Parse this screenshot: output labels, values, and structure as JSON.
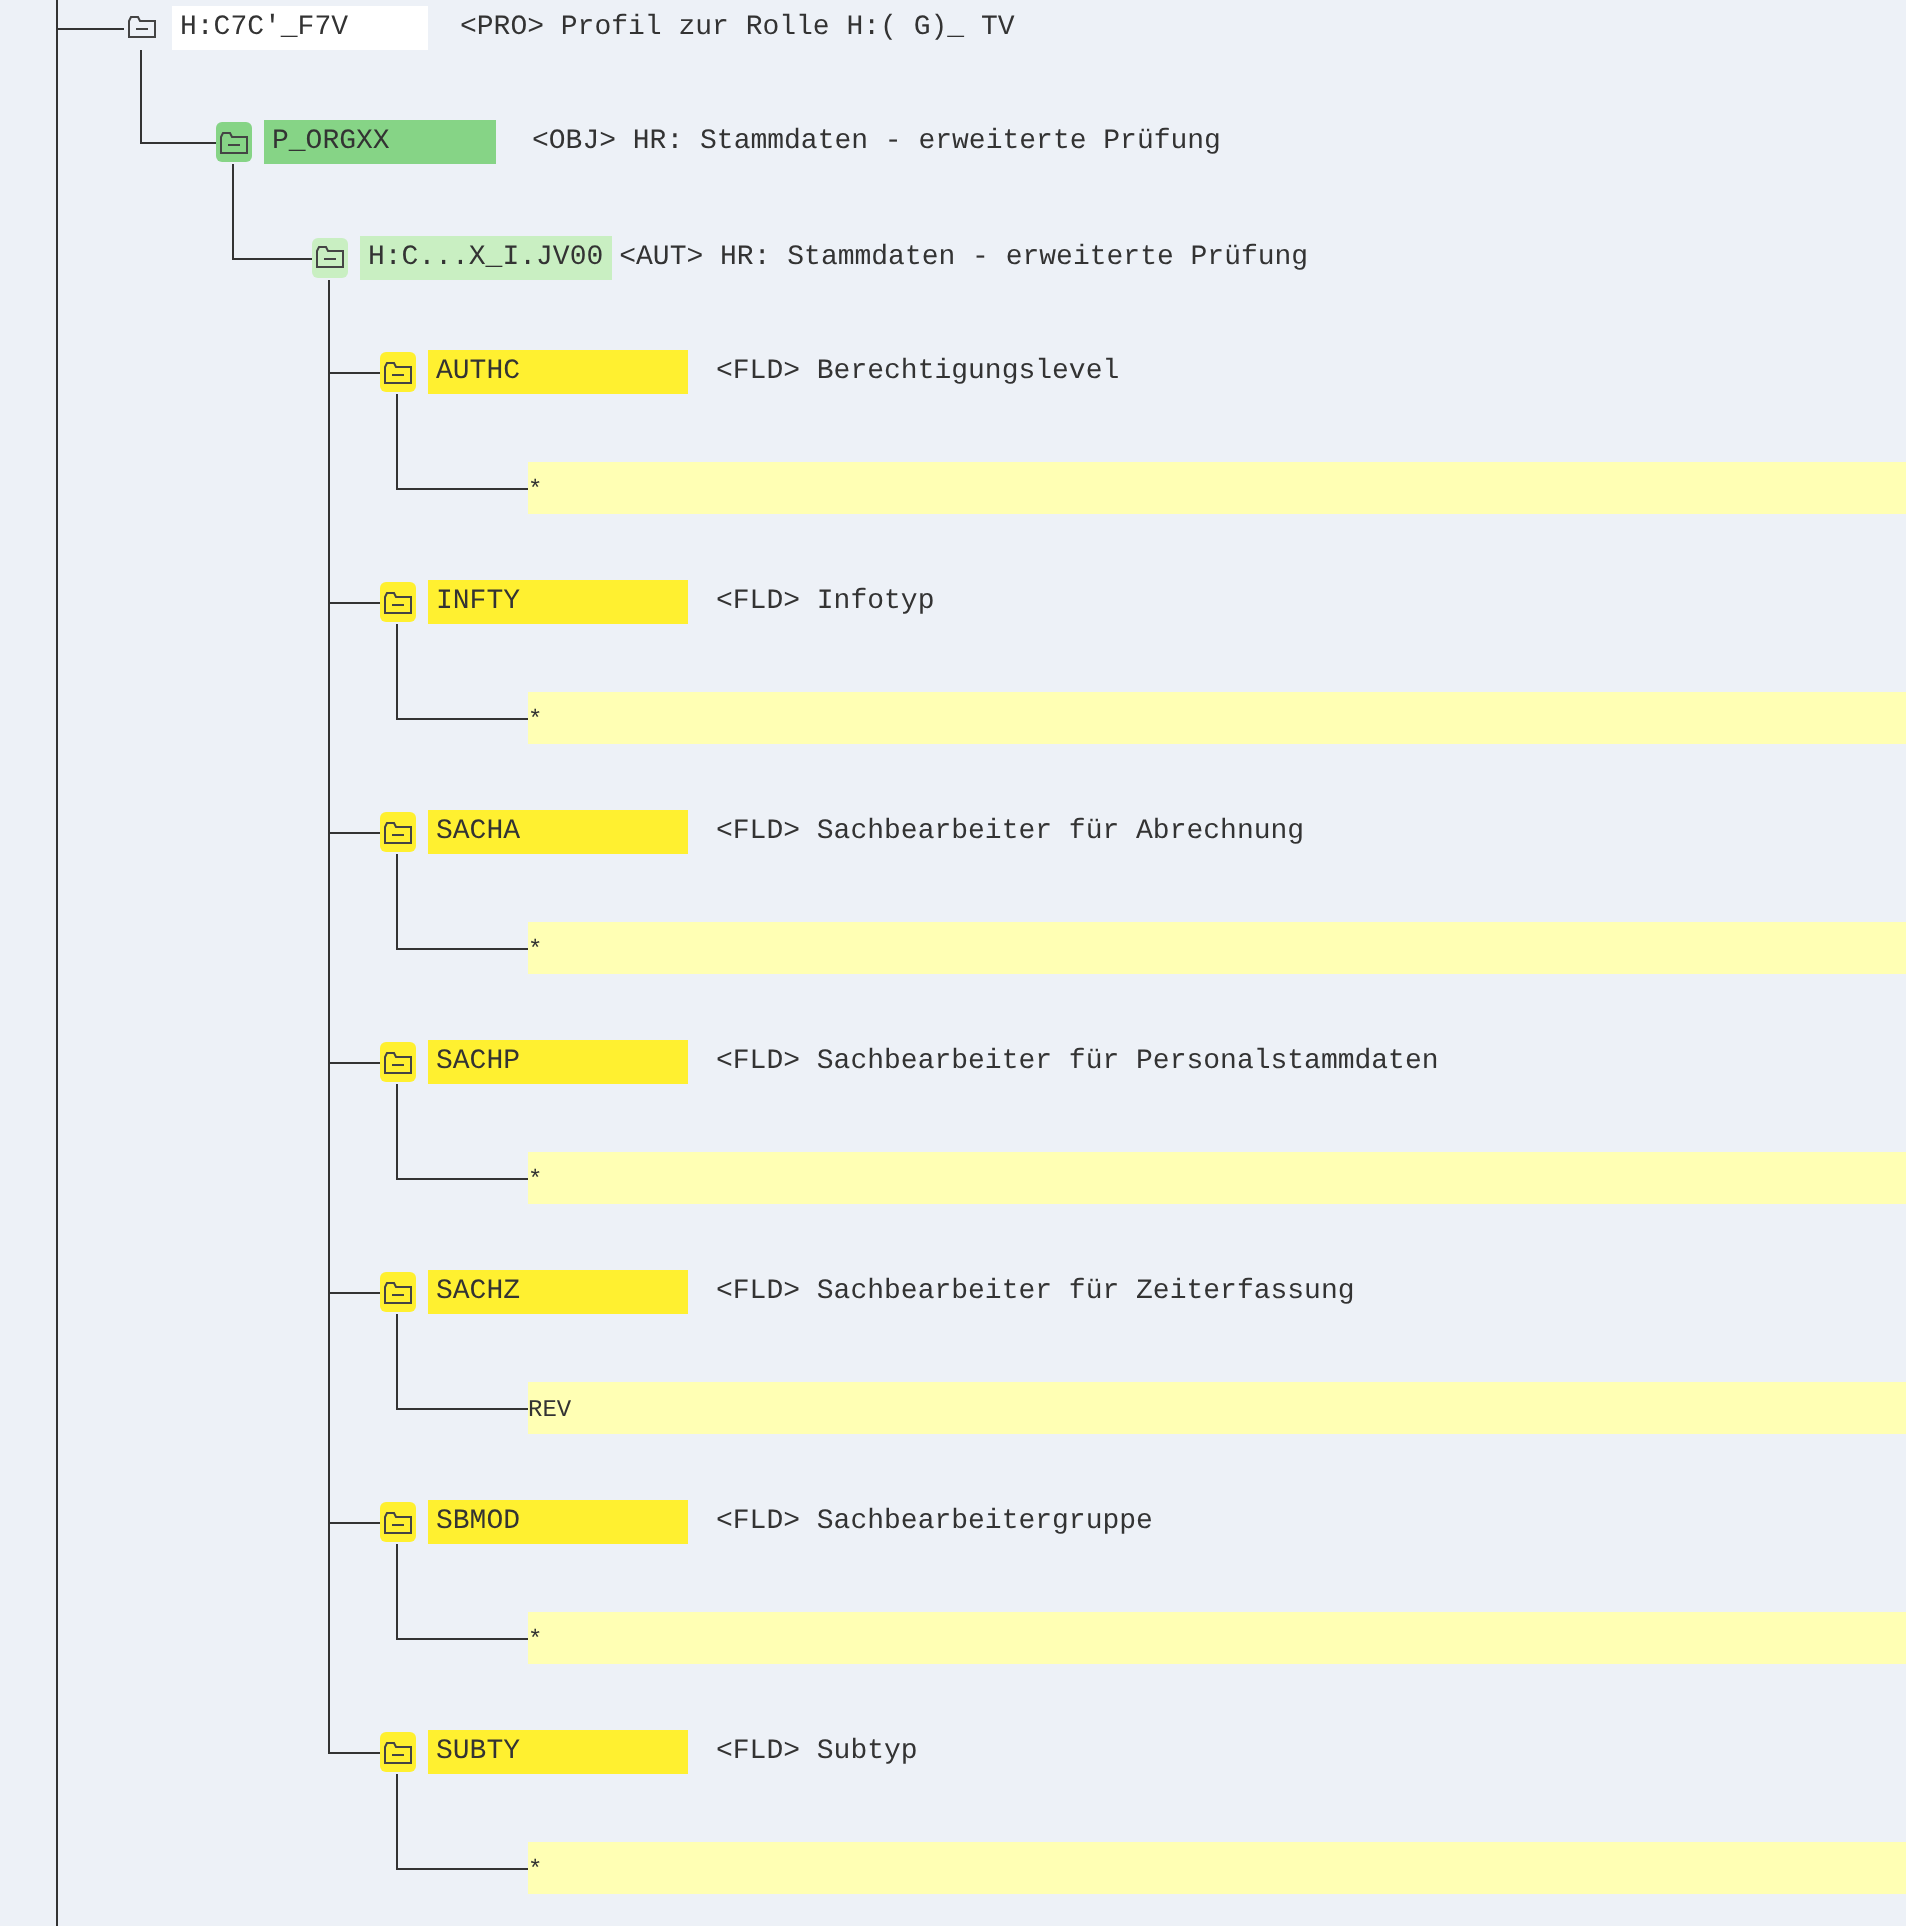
{
  "tree": [
    {
      "kind": "profile",
      "name": "H:C7C'_F7V",
      "description": "<PRO> Profil zur Rolle H:( G)_ TV",
      "expanded": true,
      "children": [
        {
          "kind": "object",
          "name": "P_ORGXX",
          "description": "<OBJ> HR: Stammdaten - erweiterte Prüfung",
          "expanded": true,
          "children": [
            {
              "kind": "authorization",
              "name": "H:C...X_I.JV00",
              "description": "<AUT> HR: Stammdaten - erweiterte Prüfung",
              "expanded": true,
              "children": [
                {
                  "kind": "field",
                  "name": "AUTHC",
                  "description": "<FLD> Berechtigungslevel",
                  "expanded": true,
                  "children": [
                    {
                      "kind": "value",
                      "name": "*"
                    }
                  ]
                },
                {
                  "kind": "field",
                  "name": "INFTY",
                  "description": "<FLD> Infotyp",
                  "expanded": true,
                  "children": [
                    {
                      "kind": "value",
                      "name": "*"
                    }
                  ]
                },
                {
                  "kind": "field",
                  "name": "SACHA",
                  "description": "<FLD> Sachbearbeiter für Abrechnung",
                  "expanded": true,
                  "children": [
                    {
                      "kind": "value",
                      "name": "*"
                    }
                  ]
                },
                {
                  "kind": "field",
                  "name": "SACHP",
                  "description": "<FLD> Sachbearbeiter für Personalstammdaten",
                  "expanded": true,
                  "children": [
                    {
                      "kind": "value",
                      "name": "*"
                    }
                  ]
                },
                {
                  "kind": "field",
                  "name": "SACHZ",
                  "description": "<FLD> Sachbearbeiter für Zeiterfassung",
                  "expanded": true,
                  "children": [
                    {
                      "kind": "value",
                      "name": "REV"
                    }
                  ]
                },
                {
                  "kind": "field",
                  "name": "SBMOD",
                  "description": "<FLD> Sachbearbeitergruppe",
                  "expanded": true,
                  "children": [
                    {
                      "kind": "value",
                      "name": "*"
                    }
                  ]
                },
                {
                  "kind": "field",
                  "name": "SUBTY",
                  "description": "<FLD> Subtyp",
                  "expanded": true,
                  "children": [
                    {
                      "kind": "value",
                      "name": "*"
                    }
                  ]
                }
              ]
            }
          ]
        }
      ]
    }
  ]
}
